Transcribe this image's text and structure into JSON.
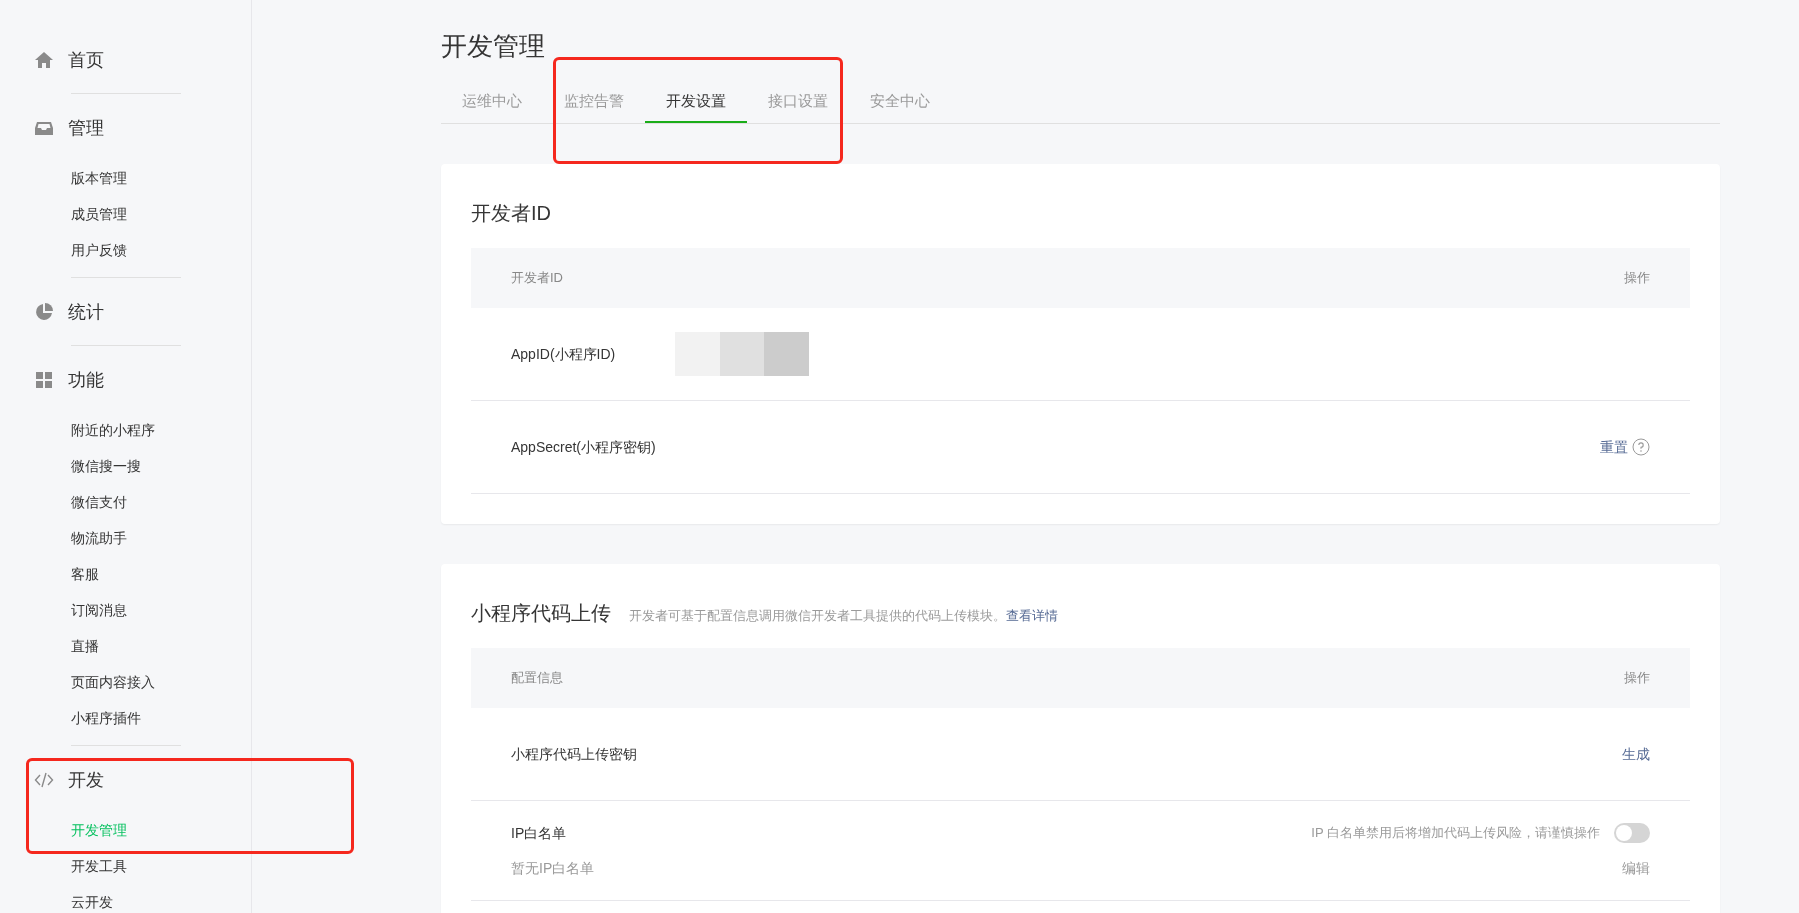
{
  "sidebar": {
    "sections": [
      {
        "label": "首页",
        "kind": "home",
        "highlighted": false
      },
      {
        "label": "管理",
        "kind": "inbox",
        "highlighted": false,
        "items": [
          {
            "label": "版本管理",
            "selected": false
          },
          {
            "label": "成员管理",
            "selected": false
          },
          {
            "label": "用户反馈",
            "selected": false
          }
        ]
      },
      {
        "label": "统计",
        "kind": "pie",
        "highlighted": false
      },
      {
        "label": "功能",
        "kind": "grid",
        "highlighted": false,
        "items": [
          {
            "label": "附近的小程序",
            "selected": false
          },
          {
            "label": "微信搜一搜",
            "selected": false
          },
          {
            "label": "微信支付",
            "selected": false
          },
          {
            "label": "物流助手",
            "selected": false
          },
          {
            "label": "客服",
            "selected": false
          },
          {
            "label": "订阅消息",
            "selected": false
          },
          {
            "label": "直播",
            "selected": false
          },
          {
            "label": "页面内容接入",
            "selected": false
          },
          {
            "label": "小程序插件",
            "selected": false
          }
        ]
      },
      {
        "label": "开发",
        "kind": "code",
        "highlighted": true,
        "items": [
          {
            "label": "开发管理",
            "selected": true
          },
          {
            "label": "开发工具",
            "selected": false
          },
          {
            "label": "云开发",
            "selected": false
          }
        ]
      }
    ]
  },
  "page": {
    "title": "开发管理",
    "tabs_highlighted": true,
    "tabs": [
      {
        "label": "运维中心",
        "selected": false
      },
      {
        "label": "监控告警",
        "selected": false
      },
      {
        "label": "开发设置",
        "selected": true
      },
      {
        "label": "接口设置",
        "selected": false
      },
      {
        "label": "安全中心",
        "selected": false
      }
    ],
    "cards": [
      {
        "title": "开发者ID",
        "columns": [
          "开发者ID",
          "操作"
        ],
        "rows": [
          {
            "kind": "masked",
            "label": "AppID(小程序ID)"
          },
          {
            "kind": "action_help",
            "label": "AppSecret(小程序密钥)",
            "action": "重置"
          }
        ]
      },
      {
        "title": "小程序代码上传",
        "description": "开发者可基于配置信息调用微信开发者工具提供的代码上传模块。",
        "link": "查看详情",
        "columns": [
          "配置信息",
          "操作"
        ],
        "rows": [
          {
            "kind": "action",
            "label": "小程序代码上传密钥",
            "action": "生成"
          },
          {
            "kind": "whitelist",
            "label": "IP白名单",
            "note": "IP 白名单禁用后将增加代码上传风险，请谨慎操作",
            "on": false,
            "empty_text": "暂无IP白名单",
            "action": "编辑"
          }
        ]
      }
    ]
  }
}
